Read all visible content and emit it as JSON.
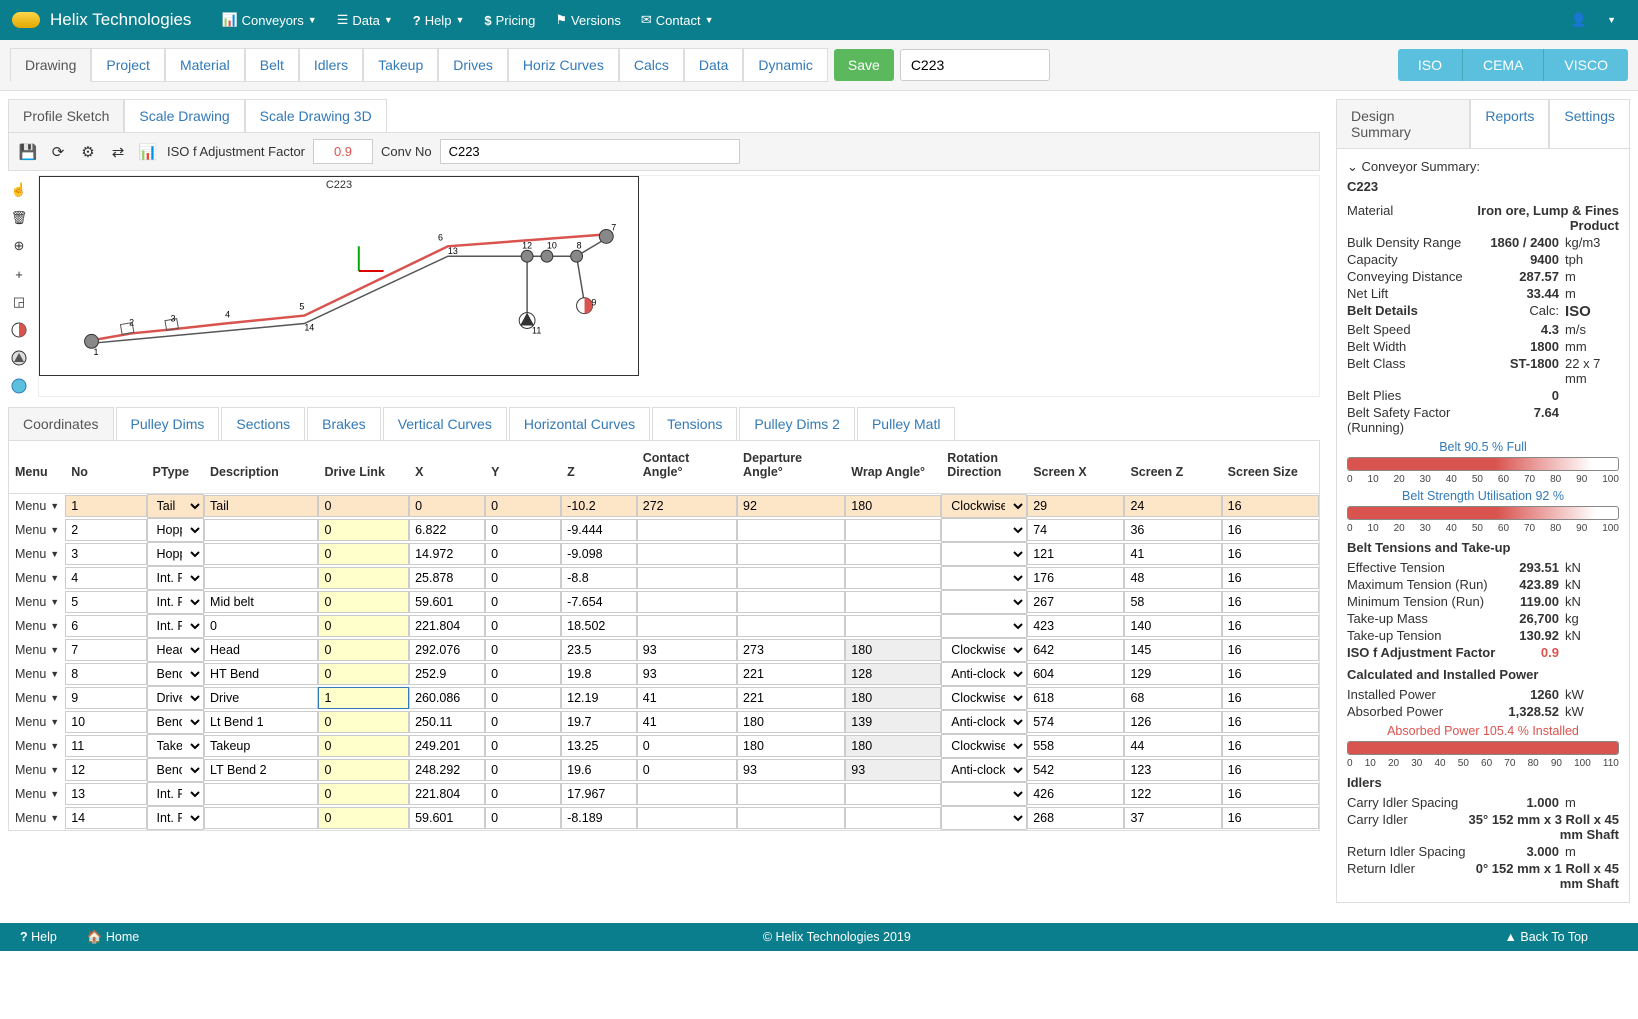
{
  "nav": {
    "brand": "Helix Technologies",
    "items": [
      "Conveyors",
      "Data",
      "Help",
      "Pricing",
      "Versions",
      "Contact"
    ]
  },
  "tabs": [
    "Drawing",
    "Project",
    "Material",
    "Belt",
    "Idlers",
    "Takeup",
    "Drives",
    "Horiz Curves",
    "Calcs",
    "Data",
    "Dynamic"
  ],
  "save": "Save",
  "conv_input": "C223",
  "calc_btns": [
    "ISO",
    "CEMA",
    "VISCO"
  ],
  "subtabs": [
    "Profile Sketch",
    "Scale Drawing",
    "Scale Drawing 3D"
  ],
  "toolbar": {
    "iso_label": "ISO f Adjustment Factor",
    "iso_value": "0.9",
    "convno_label": "Conv No",
    "convno_value": "C223"
  },
  "canvas_label": "C223",
  "coord_tabs": [
    "Coordinates",
    "Pulley Dims",
    "Sections",
    "Brakes",
    "Vertical Curves",
    "Horizontal Curves",
    "Tensions",
    "Pulley Dims 2",
    "Pulley Matl"
  ],
  "grid": {
    "headers": [
      "Menu",
      "No",
      "PType",
      "Description",
      "Drive Link",
      "X",
      "Y",
      "Z",
      "Contact Angle°",
      "Departure Angle°",
      "Wrap Angle°",
      "Rotation Direction",
      "Screen X",
      "Screen Z",
      "Screen Size"
    ],
    "rows": [
      {
        "no": "1",
        "ptype": "Tail",
        "desc": "Tail",
        "dl": "0",
        "x": "0",
        "y": "0",
        "z": "-10.2",
        "ca": "272",
        "da": "92",
        "wa": "180",
        "rd": "Clockwise",
        "sx": "29",
        "sz": "24",
        "ss": "16",
        "hl": true
      },
      {
        "no": "2",
        "ptype": "Hopper",
        "desc": "",
        "dl": "0",
        "x": "6.822",
        "y": "0",
        "z": "-9.444",
        "ca": "",
        "da": "",
        "wa": "",
        "rd": "",
        "sx": "74",
        "sz": "36",
        "ss": "16"
      },
      {
        "no": "3",
        "ptype": "Hopper",
        "desc": "",
        "dl": "0",
        "x": "14.972",
        "y": "0",
        "z": "-9.098",
        "ca": "",
        "da": "",
        "wa": "",
        "rd": "",
        "sx": "121",
        "sz": "41",
        "ss": "16"
      },
      {
        "no": "4",
        "ptype": "Int. Pt",
        "desc": "",
        "dl": "0",
        "x": "25.878",
        "y": "0",
        "z": "-8.8",
        "ca": "",
        "da": "",
        "wa": "",
        "rd": "",
        "sx": "176",
        "sz": "48",
        "ss": "16"
      },
      {
        "no": "5",
        "ptype": "Int. Pt",
        "desc": "Mid belt",
        "dl": "0",
        "x": "59.601",
        "y": "0",
        "z": "-7.654",
        "ca": "",
        "da": "",
        "wa": "",
        "rd": "",
        "sx": "267",
        "sz": "58",
        "ss": "16"
      },
      {
        "no": "6",
        "ptype": "Int. Pt",
        "desc": "0",
        "dl": "0",
        "x": "221.804",
        "y": "0",
        "z": "18.502",
        "ca": "",
        "da": "",
        "wa": "",
        "rd": "",
        "sx": "423",
        "sz": "140",
        "ss": "16"
      },
      {
        "no": "7",
        "ptype": "Head",
        "desc": "Head",
        "dl": "0",
        "x": "292.076",
        "y": "0",
        "z": "23.5",
        "ca": "93",
        "da": "273",
        "wa": "180",
        "rd": "Clockwise",
        "sx": "642",
        "sz": "145",
        "ss": "16",
        "wa_gray": true
      },
      {
        "no": "8",
        "ptype": "Bend",
        "desc": "HT Bend",
        "dl": "0",
        "x": "252.9",
        "y": "0",
        "z": "19.8",
        "ca": "93",
        "da": "221",
        "wa": "128",
        "rd": "Anti-clockwise",
        "sx": "604",
        "sz": "129",
        "ss": "16",
        "wa_gray": true
      },
      {
        "no": "9",
        "ptype": "Drive",
        "desc": "Drive",
        "dl": "1",
        "x": "260.086",
        "y": "0",
        "z": "12.19",
        "ca": "41",
        "da": "221",
        "wa": "180",
        "rd": "Clockwise",
        "sx": "618",
        "sz": "68",
        "ss": "16",
        "wa_gray": true,
        "dl_sel": true
      },
      {
        "no": "10",
        "ptype": "Bend",
        "desc": "Lt Bend 1",
        "dl": "0",
        "x": "250.11",
        "y": "0",
        "z": "19.7",
        "ca": "41",
        "da": "180",
        "wa": "139",
        "rd": "Anti-clockwise",
        "sx": "574",
        "sz": "126",
        "ss": "16",
        "wa_gray": true
      },
      {
        "no": "11",
        "ptype": "Takeup",
        "desc": "Takeup",
        "dl": "0",
        "x": "249.201",
        "y": "0",
        "z": "13.25",
        "ca": "0",
        "da": "180",
        "wa": "180",
        "rd": "Clockwise",
        "sx": "558",
        "sz": "44",
        "ss": "16",
        "wa_gray": true
      },
      {
        "no": "12",
        "ptype": "Bend",
        "desc": "LT Bend 2",
        "dl": "0",
        "x": "248.292",
        "y": "0",
        "z": "19.6",
        "ca": "0",
        "da": "93",
        "wa": "93",
        "rd": "Anti-clockwise",
        "sx": "542",
        "sz": "123",
        "ss": "16",
        "wa_gray": true
      },
      {
        "no": "13",
        "ptype": "Int. Pt",
        "desc": "",
        "dl": "0",
        "x": "221.804",
        "y": "0",
        "z": "17.967",
        "ca": "",
        "da": "",
        "wa": "",
        "rd": "",
        "sx": "426",
        "sz": "122",
        "ss": "16"
      },
      {
        "no": "14",
        "ptype": "Int. Pt",
        "desc": "",
        "dl": "0",
        "x": "59.601",
        "y": "0",
        "z": "-8.189",
        "ca": "",
        "da": "",
        "wa": "",
        "rd": "",
        "sx": "268",
        "sz": "37",
        "ss": "16"
      }
    ]
  },
  "rtabs": [
    "Design Summary",
    "Reports",
    "Settings"
  ],
  "summary": {
    "title": "Conveyor Summary:",
    "code": "C223",
    "material_label": "Material",
    "material_value": "Iron ore, Lump & Fines Product",
    "rows1": [
      {
        "l": "Bulk Density Range",
        "v": "1860 / 2400",
        "u": "kg/m3"
      },
      {
        "l": "Capacity",
        "v": "9400",
        "u": "tph"
      },
      {
        "l": "Conveying Distance",
        "v": "287.57",
        "u": "m"
      },
      {
        "l": "Net Lift",
        "v": "33.44",
        "u": "m"
      }
    ],
    "belt_details": "Belt Details",
    "calc_label": "Calc:",
    "calc_value": "ISO",
    "rows2": [
      {
        "l": "Belt Speed",
        "v": "4.3",
        "u": "m/s"
      },
      {
        "l": "Belt Width",
        "v": "1800",
        "u": "mm"
      },
      {
        "l": "Belt Class",
        "v": "ST-1800",
        "u": "22 x 7 mm"
      },
      {
        "l": "Belt Plies",
        "v": "0",
        "u": ""
      },
      {
        "l": "Belt Safety Factor (Running)",
        "v": "7.64",
        "u": ""
      }
    ],
    "gauge1": {
      "label": "Belt 90.5 % Full",
      "pct": 90.5
    },
    "gauge2": {
      "label": "Belt Strength Utilisation 92 %",
      "pct": 92
    },
    "tensions_title": "Belt Tensions and Take-up",
    "rows3": [
      {
        "l": "Effective Tension",
        "v": "293.51",
        "u": "kN"
      },
      {
        "l": "Maximum Tension (Run)",
        "v": "423.89",
        "u": "kN"
      },
      {
        "l": "Minimum Tension (Run)",
        "v": "119.00",
        "u": "kN"
      },
      {
        "l": "Take-up Mass",
        "v": "26,700",
        "u": "kg"
      },
      {
        "l": "Take-up Tension",
        "v": "130.92",
        "u": "kN"
      }
    ],
    "iso_f": {
      "l": "ISO f Adjustment Factor",
      "v": "0.9"
    },
    "power_title": "Calculated and Installed Power",
    "rows4": [
      {
        "l": "Installed Power",
        "v": "1260",
        "u": "kW"
      },
      {
        "l": "Absorbed Power",
        "v": "1,328.52",
        "u": "kW"
      }
    ],
    "gauge3": {
      "label": "Absorbed Power 105.4 % Installed",
      "pct": 105.4
    },
    "idlers_title": "Idlers",
    "rows5": [
      {
        "l": "Carry Idler Spacing",
        "v": "1.000",
        "u": "m"
      },
      {
        "l": "Carry Idler",
        "v": "35° 152 mm x 3 Roll x 45 mm Shaft",
        "u": "",
        "wide": true
      },
      {
        "l": "Return Idler Spacing",
        "v": "3.000",
        "u": "m"
      },
      {
        "l": "Return Idler",
        "v": "0° 152 mm x 1 Roll x 45 mm Shaft",
        "u": "",
        "wide": true
      }
    ]
  },
  "ticks": [
    "0",
    "10",
    "20",
    "30",
    "40",
    "50",
    "60",
    "70",
    "80",
    "90",
    "100"
  ],
  "ticks110": [
    "0",
    "10",
    "20",
    "30",
    "40",
    "50",
    "60",
    "70",
    "80",
    "90",
    "100",
    "110"
  ],
  "footer": {
    "help": "Help",
    "home": "Home",
    "copy": "© Helix Technologies 2019",
    "top": "Back To Top"
  }
}
